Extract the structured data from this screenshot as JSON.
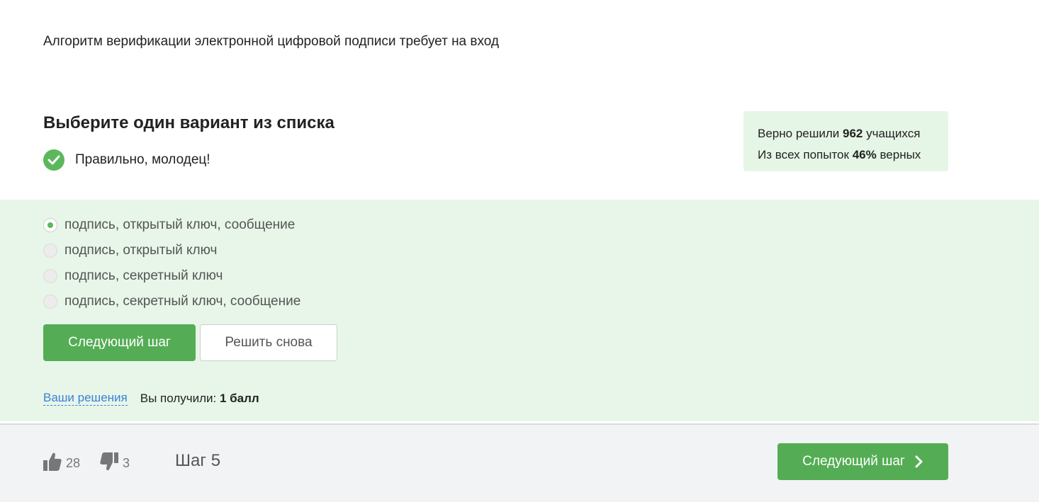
{
  "question": {
    "text": "Алгоритм верификации электронной цифровой подписи требует на вход"
  },
  "task": {
    "title": "Выберите один вариант из списка",
    "result_text": "Правильно, молодец!"
  },
  "stats": {
    "line1_prefix": "Верно решили ",
    "line1_value": "962",
    "line1_suffix": " учащихся",
    "line2_prefix": "Из всех попыток ",
    "line2_value": "46%",
    "line2_suffix": " верных"
  },
  "options": [
    {
      "label": "подпись, открытый ключ, сообщение",
      "selected": true
    },
    {
      "label": "подпись, открытый ключ",
      "selected": false
    },
    {
      "label": "подпись, секретный ключ",
      "selected": false
    },
    {
      "label": "подпись, секретный ключ, сообщение",
      "selected": false
    }
  ],
  "actions": {
    "next_label": "Следующий шаг",
    "retry_label": "Решить снова"
  },
  "solutions": {
    "link_label": "Ваши решения",
    "score_prefix": "Вы получили: ",
    "score_value": "1 балл"
  },
  "footer": {
    "likes": "28",
    "dislikes": "3",
    "step_label": "Шаг 5",
    "next_label": "Следующий шаг"
  },
  "colors": {
    "accent_green": "#54ad54",
    "panel_green": "#e7f6e8",
    "link_blue": "#3c7fd9"
  }
}
